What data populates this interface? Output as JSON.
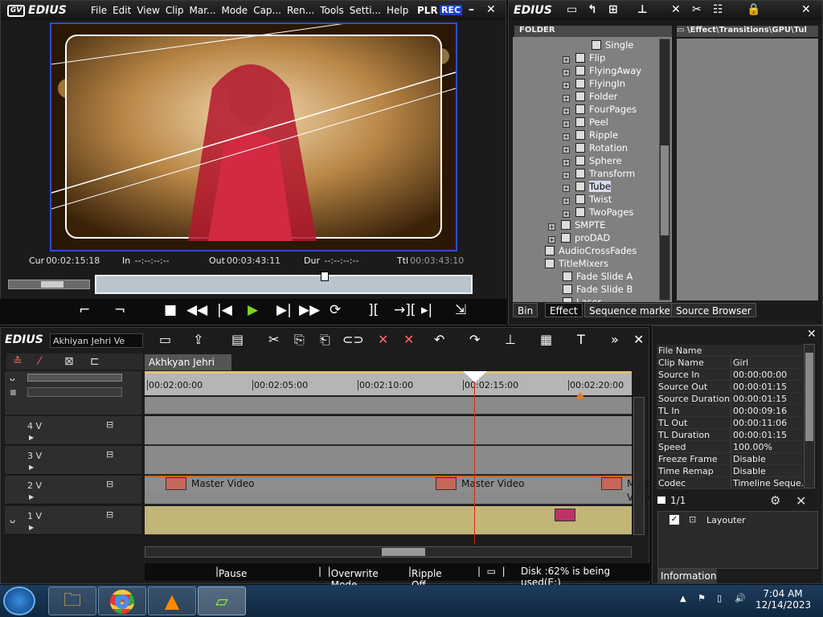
{
  "player": {
    "logo": "EDIUS",
    "menu": [
      "File",
      "Edit",
      "View",
      "Clip",
      "Mar...",
      "Mode",
      "Cap...",
      "Ren...",
      "Tools",
      "Setti...",
      "Help"
    ],
    "plr": "PLR",
    "rec": "REC",
    "cur_label": "Cur",
    "cur": "00:02:15:18",
    "in_label": "In",
    "in": "--:--:--:--",
    "out_label": "Out",
    "out": "00:03:43:11",
    "dur_label": "Dur",
    "dur": "--:--:--:--",
    "ttl_label": "Ttl",
    "ttl": "00:03:43:10"
  },
  "bin": {
    "logo": "EDIUS",
    "folder_header": "FOLDER",
    "path": "\\Effect\\Transitions\\GPU\\Tul",
    "items": [
      "Single",
      "Flip",
      "FlyingAway",
      "FlyingIn",
      "Folder",
      "FourPages",
      "Peel",
      "Ripple",
      "Rotation",
      "Sphere",
      "Transform",
      "Tube",
      "Twist",
      "TwoPages",
      "SMPTE",
      "proDAD",
      "AudioCrossFades",
      "TitleMixers",
      "Fade Slide A",
      "Fade Slide B",
      "Laser"
    ],
    "selected": "Tube",
    "tabs": [
      "Bin",
      "Effect",
      "Sequence marker",
      "Source Browser"
    ]
  },
  "timeline": {
    "logo": "EDIUS",
    "project": "Akhiyan Jehri Ve",
    "seq_tab": "Akhkyan Jehri v...",
    "ruler": [
      "00:02:00:00",
      "00:02:05:00",
      "00:02:10:00",
      "00:02:15:00",
      "00:02:20:00"
    ],
    "tracks": [
      "4 V",
      "3 V",
      "2 V",
      "1 V"
    ],
    "clip_label": "Master Video"
  },
  "info": {
    "rows": [
      [
        "File Name",
        ""
      ],
      [
        "Clip Name",
        "Girl"
      ],
      [
        "Source In",
        "00:00:00:00"
      ],
      [
        "Source Out",
        "00:00:01:15"
      ],
      [
        "Source Duration",
        "00:00:01:15"
      ],
      [
        "TL In",
        "00:00:09:16"
      ],
      [
        "TL Out",
        "00:00:11:06"
      ],
      [
        "TL Duration",
        "00:00:01:15"
      ],
      [
        "Speed",
        "100.00%"
      ],
      [
        "Freeze Frame",
        "Disable"
      ],
      [
        "Time Remap",
        "Disable"
      ],
      [
        "Codec",
        "Timeline Seque..."
      ]
    ],
    "page": "1/1",
    "layouter": "Layouter",
    "tab": "Information"
  },
  "status": {
    "pause": "Pause",
    "overwrite": "Overwrite Mode",
    "ripple": "Ripple Off",
    "disk": "Disk :62% is being used(E:)"
  },
  "clock": {
    "time": "7:04 AM",
    "date": "12/14/2023"
  }
}
